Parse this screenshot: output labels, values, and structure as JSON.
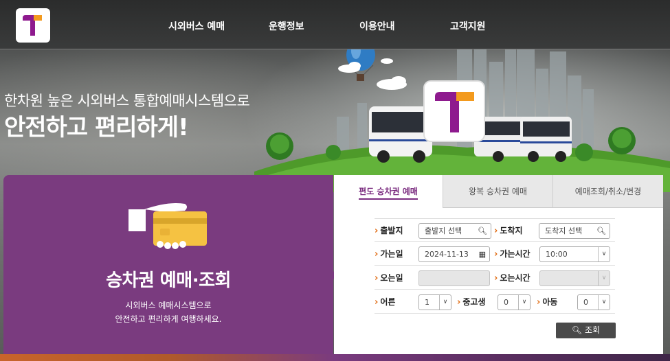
{
  "nav": {
    "items": [
      {
        "label": "시외버스 예매"
      },
      {
        "label": "운행정보"
      },
      {
        "label": "이용안내"
      },
      {
        "label": "고객지원"
      }
    ]
  },
  "hero": {
    "subtitle": "한차원 높은 시외버스 통합예매시스템으로",
    "title": "안전하고 편리하게!"
  },
  "card": {
    "title": "승차권 예매·조회",
    "desc_line1": "시외버스 예매시스템으로",
    "desc_line2": "안전하고 편리하게 여행하세요."
  },
  "tabs": [
    {
      "label": "편도 승차권 예매",
      "active": true
    },
    {
      "label": "왕복 승차권 예매",
      "active": false
    },
    {
      "label": "예매조회/취소/변경",
      "active": false
    }
  ],
  "form": {
    "departure_label": "출발지",
    "departure_value": "출발지 선택",
    "arrival_label": "도착지",
    "arrival_value": "도착지 선택",
    "go_date_label": "가는일",
    "go_date_value": "2024-11-13",
    "go_time_label": "가는시간",
    "go_time_value": "10:00",
    "return_date_label": "오는일",
    "return_date_value": "",
    "return_time_label": "오는시간",
    "return_time_value": "",
    "adult_label": "어른",
    "adult_value": "1",
    "youth_label": "중고생",
    "youth_value": "0",
    "child_label": "아동",
    "child_value": "0",
    "search_label": "조회"
  },
  "colors": {
    "brand_purple": "#7a3b7f",
    "brand_orange": "#f39a1e",
    "accent_orange": "#e06a10",
    "search_button": "#4a4a4a"
  }
}
